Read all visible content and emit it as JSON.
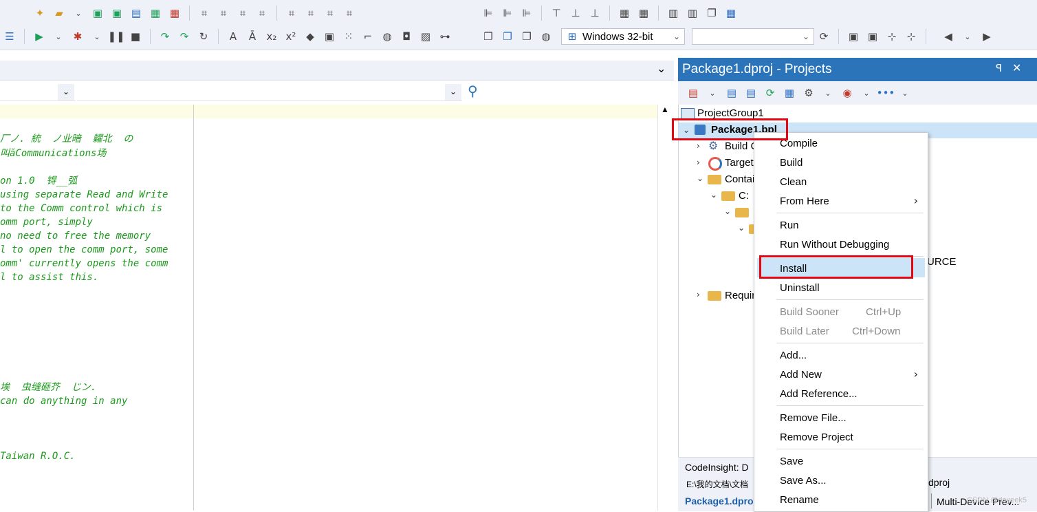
{
  "toolbar": {
    "platform_combo": "Windows 32-bit",
    "config_combo": ""
  },
  "editor": {
    "code_lines": [
      "厂ノ. 統  ノ业暗  糶北  の",
      "叫ăCommunications场",
      "on 1.0  锝__弧",
      "using separate Read and Write",
      "to the Comm control which is",
      "omm port, simply",
      "no need to free the memory",
      "l to open the comm port, some",
      "omm' currently opens the comm",
      "l to assist this.",
      "埃  虫缝砸芥  じン.",
      "can do anything in any",
      "Taiwan R.O.C."
    ]
  },
  "projects": {
    "title": "Package1.dproj - Projects",
    "items": {
      "group": "ProjectGroup1",
      "package": "Package1.bpl",
      "build": "Build C",
      "target": "Target",
      "contains": "Contai",
      "c_folder": "C:",
      "urce": "URCE",
      "requires": "Requir"
    },
    "status": {
      "codeinsight": "CodeInsight: D",
      "path": "E:\\我的文档\\文档",
      "dproj": "dproj",
      "tab_active": "Package1.dpro",
      "tab_other": "Multi-Device Prev...",
      "watermark": "CSDN @doyeek5"
    }
  },
  "context_menu": {
    "compile": "Compile",
    "build": "Build",
    "clean": "Clean",
    "from_here": "From Here",
    "run": "Run",
    "run_without_debugging": "Run Without Debugging",
    "install": "Install",
    "uninstall": "Uninstall",
    "build_sooner": "Build Sooner",
    "build_sooner_shortcut": "Ctrl+Up",
    "build_later": "Build Later",
    "build_later_shortcut": "Ctrl+Down",
    "add": "Add...",
    "add_new": "Add New",
    "add_reference": "Add Reference...",
    "remove_file": "Remove File...",
    "remove_project": "Remove Project",
    "save": "Save",
    "save_as": "Save As...",
    "rename": "Rename"
  },
  "colors": {
    "accent": "#2b74b9",
    "highlight_box": "#e30613",
    "code_comment": "#1a9a1a"
  }
}
